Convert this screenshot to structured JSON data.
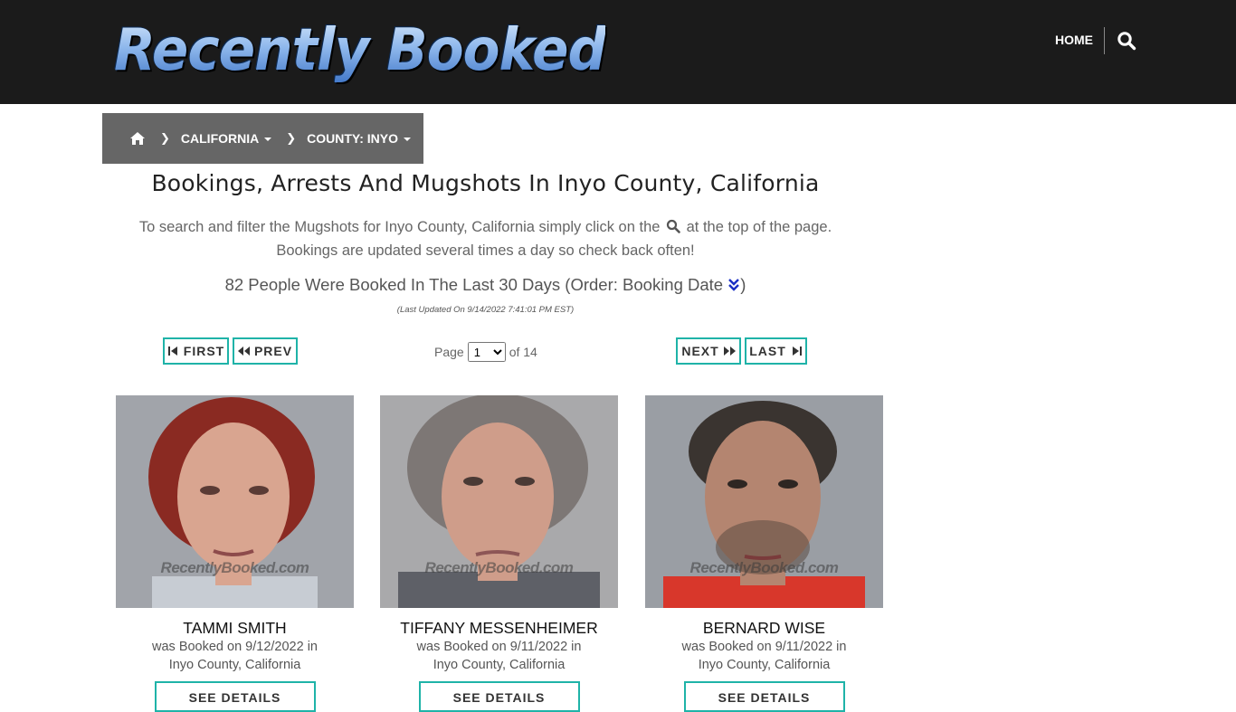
{
  "header": {
    "logo_text": "Recently Booked",
    "nav_home": "HOME",
    "search_icon": "search-icon"
  },
  "breadcrumb": {
    "home_icon": "home-icon",
    "state": "CALIFORNIA",
    "county": "COUNTY: INYO"
  },
  "main": {
    "title": "Bookings, Arrests And Mugshots In Inyo County, California",
    "intro_before_icon": "To search and filter the Mugshots for Inyo County, California simply click on the",
    "intro_after_icon": "at the top of the page.",
    "intro_line2": "Bookings are updated several times a day so check back often!",
    "count_text": "82 People Were Booked In The Last 30 Days (Order: Booking Date",
    "count_close": ")",
    "last_updated": "(Last Updated On 9/14/2022 7:41:01 PM EST)"
  },
  "pager": {
    "first": "FIRST",
    "prev": "PREV",
    "next": "NEXT",
    "last": "LAST",
    "page_label": "Page",
    "current_page": "1",
    "of_label": "of 14"
  },
  "cards": [
    {
      "name": "TAMMI SMITH",
      "booked": "was Booked on 9/12/2022 in",
      "location": "Inyo County, California",
      "details": "SEE DETAILS",
      "watermark": "RecentlyBooked.com",
      "hair_color": "#8a2a22",
      "skin_color": "#d9a590",
      "shirt_color": "#c7ccd3"
    },
    {
      "name": "TIFFANY MESSENHEIMER",
      "booked": "was Booked on 9/11/2022 in",
      "location": "Inyo County, California",
      "details": "SEE DETAILS",
      "watermark": "RecentlyBooked.com",
      "hair_color": "#7d7775",
      "skin_color": "#cf9d8a",
      "shirt_color": "#5e6067"
    },
    {
      "name": "BERNARD WISE",
      "booked": "was Booked on 9/11/2022 in",
      "location": "Inyo County, California",
      "details": "SEE DETAILS",
      "watermark": "RecentlyBooked.com",
      "hair_color": "#3a3430",
      "skin_color": "#b48570",
      "shirt_color": "#d8372b"
    }
  ],
  "colors": {
    "header_bg": "#1b1b1b",
    "breadcrumb_bg": "#666666",
    "accent_border": "#1fb3a8",
    "order_icon": "#1a2fc4"
  }
}
